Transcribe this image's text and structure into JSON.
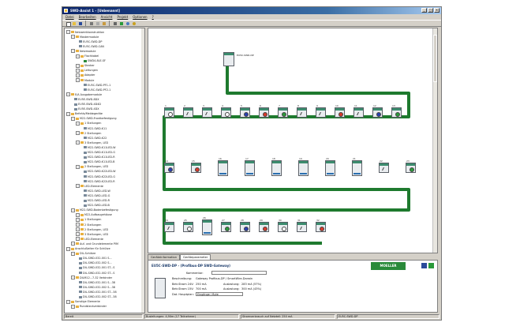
{
  "window": {
    "title": "SWD-Assist 1 - [Unbenannt]"
  },
  "menu": [
    "Datei",
    "Bearbeiten",
    "Ansicht",
    "Projekt",
    "Optionen",
    "?"
  ],
  "tree": [
    {
      "label": "Netzwerkkonstruktion",
      "level": 0,
      "icon": "folder-icon"
    },
    {
      "label": "Mastermodule",
      "level": 1,
      "icon": "folder-icon"
    },
    {
      "label": "EU5C-SWD-DP",
      "level": 2,
      "icon": "module-icon"
    },
    {
      "label": "EU5C-SWD-CAN",
      "level": 2,
      "icon": "module-icon"
    },
    {
      "label": "Netzmodule",
      "level": 1,
      "icon": "folder-icon"
    },
    {
      "label": "Flachkabel",
      "level": 2,
      "icon": "folder-icon"
    },
    {
      "label": "SWD4-8LE-SF",
      "level": 3,
      "icon": "cable-icon"
    },
    {
      "label": "Stecker",
      "level": 2,
      "icon": "folder-icon"
    },
    {
      "label": "Leitungen",
      "level": 2,
      "icon": "folder-icon"
    },
    {
      "label": "Adapter",
      "level": 2,
      "icon": "folder-icon"
    },
    {
      "label": "Module",
      "level": 2,
      "icon": "folder-icon"
    },
    {
      "label": "EU5C-SWD-PF1-1",
      "level": 3,
      "icon": "module-icon"
    },
    {
      "label": "EU5C-SWD-PF2-1",
      "level": 3,
      "icon": "module-icon"
    },
    {
      "label": "E/A Ausgabemodule",
      "level": 0,
      "icon": "folder-icon"
    },
    {
      "label": "EU5E-SWD-8DX",
      "level": 1,
      "icon": "module-icon"
    },
    {
      "label": "EU5E-SWD-4D4D",
      "level": 1,
      "icon": "module-icon"
    },
    {
      "label": "EU5E-SWD-4DX",
      "level": 1,
      "icon": "module-icon"
    },
    {
      "label": "Befehls/Meldegeräte",
      "level": 0,
      "icon": "folder-icon"
    },
    {
      "label": "M22-SWD-Frontbefestigung",
      "level": 1,
      "icon": "folder-icon"
    },
    {
      "label": "1 Stellungen",
      "level": 2,
      "icon": "folder-icon"
    },
    {
      "label": "M22-SWD-K11",
      "level": 3,
      "icon": "module-icon"
    },
    {
      "label": "2 Stellungen",
      "level": 2,
      "icon": "folder-icon"
    },
    {
      "label": "M22-SWD-K22",
      "level": 3,
      "icon": "module-icon"
    },
    {
      "label": "3 Stellungen, LED",
      "level": 2,
      "icon": "folder-icon"
    },
    {
      "label": "M22-SWD-K11LED-W",
      "level": 3,
      "icon": "module-icon"
    },
    {
      "label": "M22-SWD-K11LED-G",
      "level": 3,
      "icon": "module-icon"
    },
    {
      "label": "M22-SWD-K11LED-R",
      "level": 3,
      "icon": "module-icon"
    },
    {
      "label": "M22-SWD-K11LED-B",
      "level": 3,
      "icon": "module-icon"
    },
    {
      "label": "2 Stellungen, LED",
      "level": 2,
      "icon": "folder-icon"
    },
    {
      "label": "M22-SWD-K22LED-W",
      "level": 3,
      "icon": "module-icon"
    },
    {
      "label": "M22-SWD-K22LED-G",
      "level": 3,
      "icon": "module-icon"
    },
    {
      "label": "M22-SWD-K22LED-R",
      "level": 3,
      "icon": "module-icon"
    },
    {
      "label": "LED-Elemente",
      "level": 2,
      "icon": "folder-icon"
    },
    {
      "label": "M22-SWD-LED-W",
      "level": 3,
      "icon": "module-icon"
    },
    {
      "label": "M22-SWD-LED-G",
      "level": 3,
      "icon": "module-icon"
    },
    {
      "label": "M22-SWD-LED-R",
      "level": 3,
      "icon": "module-icon"
    },
    {
      "label": "M22-SWD-LED-B",
      "level": 3,
      "icon": "module-icon"
    },
    {
      "label": "M22-SWD-Bodenbefestigung",
      "level": 1,
      "icon": "folder-icon"
    },
    {
      "label": "M22-Aufbaugehäuse",
      "level": 2,
      "icon": "folder-icon"
    },
    {
      "label": "1 Stellungen",
      "level": 2,
      "icon": "folder-icon"
    },
    {
      "label": "2 Stellungen",
      "level": 2,
      "icon": "folder-icon"
    },
    {
      "label": "2 Stellungen, LED",
      "level": 2,
      "icon": "folder-icon"
    },
    {
      "label": "3 Stellungen, LED",
      "level": 2,
      "icon": "folder-icon"
    },
    {
      "label": "LED-Elemente",
      "level": 2,
      "icon": "folder-icon"
    },
    {
      "label": "Auf- und Grundelemente PIM",
      "level": 1,
      "icon": "folder-icon"
    },
    {
      "label": "Anschlußleiter für Schütze",
      "level": 0,
      "icon": "folder-icon"
    },
    {
      "label": "DIL-Schütze",
      "level": 1,
      "icon": "folder-icon"
    },
    {
      "label": "DIL-SWD-032-001 S...",
      "level": 2,
      "icon": "module-icon"
    },
    {
      "label": "DIL-SWD-032-002 S...",
      "level": 2,
      "icon": "module-icon"
    },
    {
      "label": "DIL-SWD-032-001 ST...S",
      "level": 2,
      "icon": "module-icon"
    },
    {
      "label": "DIL-SWD-032-002 ST...S",
      "level": 2,
      "icon": "module-icon"
    },
    {
      "label": "DILM12...7-32 Verbinder",
      "level": 1,
      "icon": "folder-icon"
    },
    {
      "label": "DIL-SWD-032-001 S...38",
      "level": 2,
      "icon": "module-icon"
    },
    {
      "label": "DIL-SWD-032-002 S...38",
      "level": 2,
      "icon": "module-icon"
    },
    {
      "label": "DIL-SWD-032-001 ST...38",
      "level": 2,
      "icon": "module-icon"
    },
    {
      "label": "DIL-SWD-032-002 ST...38",
      "level": 2,
      "icon": "module-icon"
    },
    {
      "label": "Sonstige Elemente",
      "level": 0,
      "icon": "folder-icon"
    },
    {
      "label": "Rundsteckverbinder",
      "level": 1,
      "icon": "folder-icon"
    }
  ],
  "diagram": {
    "master_label": "EU5C-SWD-DP",
    "row1": [
      {
        "num": "1",
        "dot": "#ffffff"
      },
      {
        "num": "2",
        "dot": "switch"
      },
      {
        "num": "3",
        "dot": "switch"
      },
      {
        "num": "4",
        "dot": "#ffffff"
      },
      {
        "num": "5",
        "dot": "#2a3fb0"
      },
      {
        "num": "6",
        "dot": "#d83a2a"
      },
      {
        "num": "7",
        "dot": "#2a9a3a"
      },
      {
        "num": "8",
        "dot": "switch"
      },
      {
        "num": "9",
        "dot": "switch"
      },
      {
        "num": "10",
        "dot": "#d83a2a"
      },
      {
        "num": "11",
        "dot": "switch"
      },
      {
        "num": "12",
        "dot": "#2a3fb0"
      },
      {
        "num": "13",
        "dot": "#2a9a3a"
      }
    ],
    "row2": [
      {
        "num": "14",
        "dot": "#2a3fb0"
      },
      {
        "num": "15",
        "dot": "#d83a2a"
      },
      {
        "num": "16",
        "dot": "io"
      },
      {
        "num": "17",
        "dot": "io"
      },
      {
        "num": "18",
        "dot": "io"
      },
      {
        "num": "19",
        "dot": "io"
      },
      {
        "num": "20",
        "dot": "io"
      },
      {
        "num": "21",
        "dot": "io"
      },
      {
        "num": "22",
        "dot": "switch"
      },
      {
        "num": "23",
        "dot": "#2a9a3a"
      }
    ],
    "row3": [
      {
        "num": "24",
        "dot": "switch"
      },
      {
        "num": "25",
        "dot": "#ffffff"
      },
      {
        "num": "26",
        "dot": "io"
      },
      {
        "num": "27",
        "dot": "#2a9a3a"
      },
      {
        "num": "28",
        "dot": "#2a3fb0"
      },
      {
        "num": "29",
        "dot": "#d83a2a"
      },
      {
        "num": "30",
        "dot": "#ffffff"
      },
      {
        "num": "31",
        "dot": "switch"
      },
      {
        "num": "32",
        "dot": "#d83a2a"
      }
    ]
  },
  "panel": {
    "tabs": [
      "Geräteinformation",
      "Geräteparameter"
    ],
    "device_title": "EU5C-SWD-DP  - (Profibus-DP SWD-Gateway)",
    "brand": "MOELLER",
    "kommentar_label": "Kommentar:",
    "beschreibung_label": "Beschreibung:",
    "beschreibung_value": "Gateway Profibus-DP / SmartWire-Darwin",
    "betrstrom24_label": "Betr.Strom 24V:",
    "betrstrom24_value": "250 mA",
    "betrstrom15_label": "Betr.Strom 15V:",
    "betrstrom15_value": "700 mA",
    "auslastung1_label": "Auslastung:",
    "auslastung1_value": "283 mA (57%)",
    "auslastung2_label": "Auslastung:",
    "auslastung2_value": "300 mA (43%)",
    "dd_label": "Dat. Hauptplan:",
    "dd_value": "Eingänge / Byte"
  },
  "status": [
    "Bereit",
    "Busleitungen: 4,90m (17 Teilnehmer)",
    "Stromverbrauch auf Netzteil: 250 mA",
    "EU5C-SWD-DP"
  ]
}
